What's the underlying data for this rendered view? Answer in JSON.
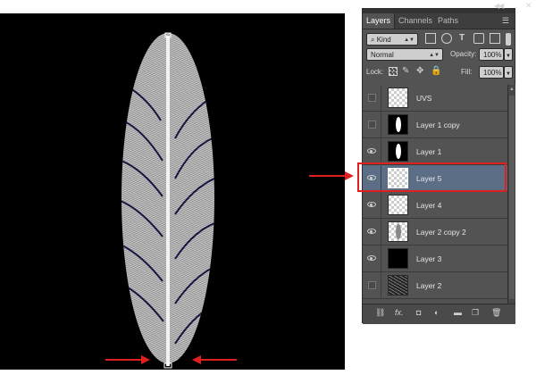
{
  "panel": {
    "tabs": [
      {
        "label": "Layers"
      },
      {
        "label": "Channels"
      },
      {
        "label": "Paths"
      }
    ],
    "filter": {
      "kind_label": "Kind"
    },
    "blend_mode": "Normal",
    "opacity_label": "Opacity:",
    "opacity_value": "100%",
    "lock_label": "Lock:",
    "fill_label": "Fill:",
    "fill_value": "100%"
  },
  "layers": [
    {
      "name": "UVS",
      "visible": false,
      "thumb": "transparent"
    },
    {
      "name": "Layer 1 copy",
      "visible": false,
      "thumb": "black-white-feather"
    },
    {
      "name": "Layer 1",
      "visible": true,
      "thumb": "black-white-feather"
    },
    {
      "name": "Layer 5",
      "visible": true,
      "thumb": "transparent",
      "selected": true
    },
    {
      "name": "Layer 4",
      "visible": true,
      "thumb": "transparent-dots"
    },
    {
      "name": "Layer 2 copy 2",
      "visible": true,
      "thumb": "transparent-grey-feather"
    },
    {
      "name": "Layer 3",
      "visible": true,
      "thumb": "black"
    },
    {
      "name": "Layer 2",
      "visible": false,
      "thumb": "texture"
    }
  ],
  "icons": {
    "eye": "eye-icon",
    "link": "link-icon",
    "fx": "fx-icon",
    "mask": "mask-icon",
    "adjustment": "adjustment-icon",
    "group": "folder-icon",
    "new_layer": "new-layer-icon",
    "delete": "trash-icon"
  },
  "colors": {
    "panel_bg": "#535353",
    "selected_row": "#5c6e86",
    "annotation_red": "#e02020",
    "canvas": "#000000"
  },
  "labels": {
    "bottom_fx": "fx."
  }
}
